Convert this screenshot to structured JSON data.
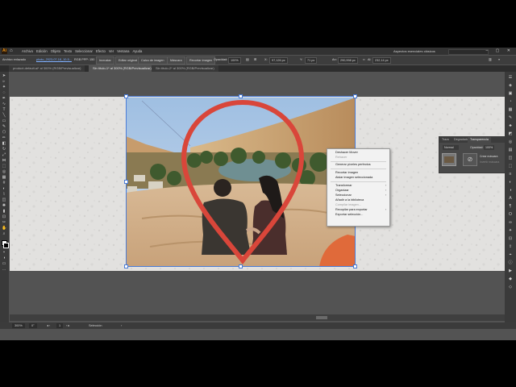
{
  "app": {
    "logo": "Ai",
    "workspace": "Aspectos esenciales clásicos"
  },
  "menu": [
    "Archivo",
    "Edición",
    "Objeto",
    "Texto",
    "Seleccionar",
    "Efecto",
    "Ver",
    "Ventana",
    "Ayuda"
  ],
  "control_bar": {
    "label": "Archivo enlazado",
    "filename": "photo_2023-07-18_10-5...",
    "profile": "RGB  PPP: 150",
    "embed_button": "Incrustar",
    "edit_original_button": "Editar original",
    "image_trace_button": "Calco de imagen",
    "mask_button": "Máscara",
    "crop_button": "Recortar imagen",
    "opacity_label": "Opacidad:",
    "opacity_value": "100%",
    "x_label": "X:",
    "x_value": "97,126 px",
    "y_label": "Y:",
    "y_value": "71 px",
    "w_label": "An:",
    "w_value": "290,998 px",
    "h_label": "Al:",
    "h_value": "232,14 px"
  },
  "tabs": [
    {
      "label": "product-default.ai* al 300% (RGB/Previsualizar)",
      "active": false
    },
    {
      "label": "Sin título-1* al 300% (RGB/Previsualizar)",
      "active": true
    },
    {
      "label": "Sin título-2* al 300% (RGB/Previsualizar)",
      "active": false
    }
  ],
  "context_menu": {
    "items": [
      {
        "label": "Deshacer Mover",
        "disabled": false,
        "submenu": false
      },
      {
        "label": "Rehacer",
        "disabled": true,
        "submenu": false
      },
      {
        "label": "Generar píxeles perfectos",
        "disabled": false,
        "submenu": false
      },
      {
        "label": "Recortar imagen",
        "disabled": false,
        "submenu": false
      },
      {
        "label": "Aislar imagen seleccionada",
        "disabled": false,
        "submenu": false
      },
      {
        "label": "Transformar",
        "disabled": false,
        "submenu": true
      },
      {
        "label": "Organizar",
        "disabled": false,
        "submenu": true
      },
      {
        "label": "Seleccionar",
        "disabled": false,
        "submenu": true
      },
      {
        "label": "Añadir a la biblioteca",
        "disabled": false,
        "submenu": false
      },
      {
        "label": "Compilar imagen...",
        "disabled": true,
        "submenu": false
      },
      {
        "label": "Recopilar para exportar",
        "disabled": false,
        "submenu": true
      },
      {
        "label": "Exportar selección...",
        "disabled": false,
        "submenu": false
      }
    ]
  },
  "transparency_panel": {
    "tabs": [
      "Trazo",
      "Degradado",
      "Transparencia"
    ],
    "blend_mode": "Normal",
    "opacity_label": "Opacidad:",
    "opacity_value": "100%",
    "clip_label": "Crear máscara",
    "invert_label": "Invertir máscara"
  },
  "status_bar": {
    "zoom": "300%",
    "angle": "0°",
    "artboard_number": "1",
    "tool_name": "Selección"
  },
  "colors": {
    "accent_pin": "#d9463a",
    "selection": "#4a7bd6"
  }
}
